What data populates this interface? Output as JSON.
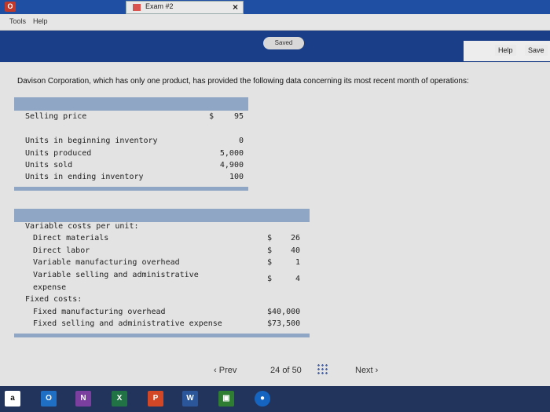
{
  "window": {
    "tab_title": "Exam #2",
    "close_glyph": "×",
    "badge": "O"
  },
  "menu": {
    "items": [
      "Tools",
      "Help"
    ]
  },
  "toolbar": {
    "saved_label": "Saved",
    "help_label": "Help",
    "save_label": "Save"
  },
  "question": {
    "intro": "Davison Corporation, which has only one product, has provided the following data concerning its most recent month of operations:"
  },
  "table1": {
    "selling_price_label": "Selling price",
    "selling_price_currency": "$",
    "selling_price_value": "95",
    "rows": [
      {
        "label": "Units in beginning inventory",
        "value": "0"
      },
      {
        "label": "Units produced",
        "value": "5,000"
      },
      {
        "label": "Units sold",
        "value": "4,900"
      },
      {
        "label": "Units in ending inventory",
        "value": "100"
      }
    ]
  },
  "table2": {
    "variable_header": "Variable costs per unit:",
    "variable_rows": [
      {
        "label": "Direct materials",
        "currency": "$",
        "value": "26"
      },
      {
        "label": "Direct labor",
        "currency": "$",
        "value": "40"
      },
      {
        "label": "Variable manufacturing overhead",
        "currency": "$",
        "value": "1"
      },
      {
        "label": "Variable selling and administrative",
        "label_cont": "expense",
        "currency": "$",
        "value": "4"
      }
    ],
    "fixed_header": "Fixed costs:",
    "fixed_rows": [
      {
        "label": "Fixed manufacturing overhead",
        "value": "$40,000"
      },
      {
        "label": "Fixed selling and administrative expense",
        "value": "$73,500"
      }
    ]
  },
  "nav": {
    "prev_label": "Prev",
    "current": "24",
    "of_label": "of",
    "total": "50",
    "next_label": "Next"
  },
  "taskbar": {
    "items": [
      {
        "icon": "amazon-icon",
        "glyph": "a",
        "color": "#ffffff"
      },
      {
        "icon": "outlook-icon",
        "glyph": "O",
        "color": "#1f6fc4"
      },
      {
        "icon": "onenote-icon",
        "glyph": "N",
        "color": "#7b3fa0"
      },
      {
        "icon": "excel-icon",
        "glyph": "X",
        "color": "#217346"
      },
      {
        "icon": "powerpoint-icon",
        "glyph": "P",
        "color": "#d24726"
      },
      {
        "icon": "word-icon",
        "glyph": "W",
        "color": "#2b579a"
      },
      {
        "icon": "store-icon",
        "glyph": "▣",
        "color": "#2e7d32"
      },
      {
        "icon": "browser-icon",
        "glyph": "●",
        "color": "#1565c0"
      }
    ]
  }
}
